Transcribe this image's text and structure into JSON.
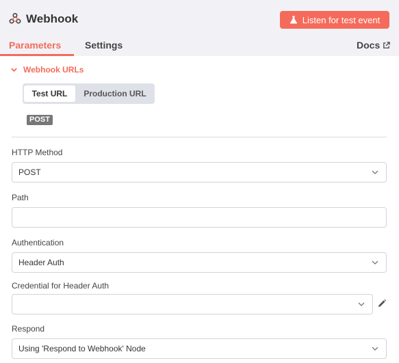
{
  "header": {
    "title": "Webhook",
    "listen_button": "Listen for test event",
    "tabs": [
      {
        "label": "Parameters"
      },
      {
        "label": "Settings"
      }
    ],
    "docs_link": "Docs"
  },
  "webhook_urls": {
    "section_label": "Webhook URLs",
    "tabs": [
      {
        "label": "Test URL"
      },
      {
        "label": "Production URL"
      }
    ],
    "method_badge": "POST"
  },
  "fields": {
    "http_method": {
      "label": "HTTP Method",
      "value": "POST"
    },
    "path": {
      "label": "Path",
      "value": ""
    },
    "authentication": {
      "label": "Authentication",
      "value": "Header Auth"
    },
    "credential": {
      "label": "Credential for Header Auth",
      "value": ""
    },
    "respond": {
      "label": "Respond",
      "value": "Using 'Respond to Webhook' Node"
    }
  },
  "colors": {
    "accent": "#f56b5b",
    "header_bg": "#f2f2f6"
  },
  "icons": [
    "webhook-icon",
    "flask-icon",
    "external-link-icon",
    "chevron-down-icon",
    "pencil-icon"
  ]
}
